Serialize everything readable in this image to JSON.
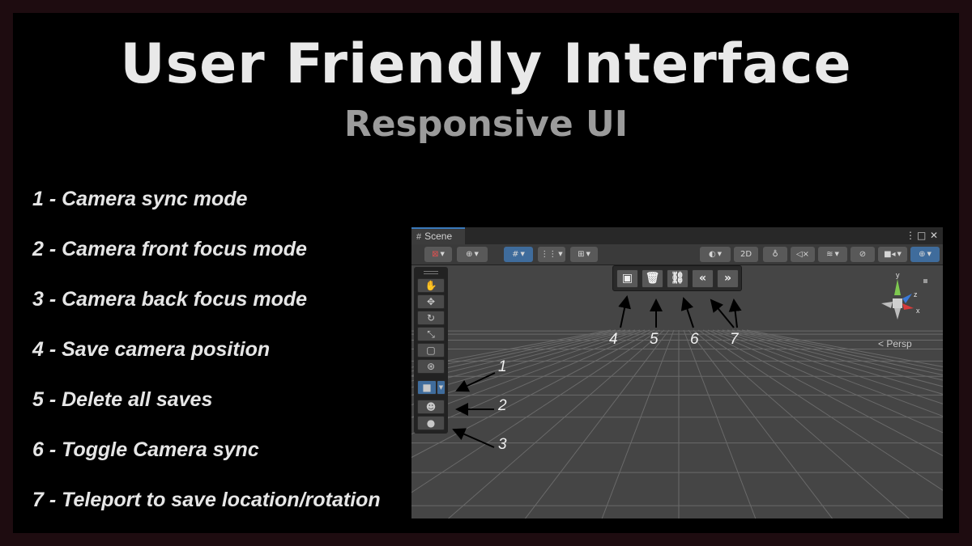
{
  "heading": {
    "title": "User Friendly Interface",
    "subtitle": "Responsive UI"
  },
  "legend": [
    "1 - Camera sync mode",
    "2 - Camera front focus mode",
    "3 - Camera back focus mode",
    "4 - Save camera position",
    "5 - Delete all saves",
    "6 - Toggle Camera sync",
    "7 - Teleport to save location/rotation"
  ],
  "scene_window": {
    "tab_label": "Scene",
    "toolbar_2d_label": "2D",
    "view_label": "Persp",
    "gizmo_axes": {
      "y": "y",
      "z": "z",
      "x": "x"
    },
    "accent_color": "#3f6c9c"
  },
  "overlay_toolbar": {
    "icons": [
      "save-icon",
      "delete-icon",
      "link-icon",
      "double-chevron-left-icon",
      "double-chevron-right-icon"
    ]
  },
  "callout_numbers": {
    "n1": "1",
    "n2": "2",
    "n3": "3",
    "n4": "4",
    "n5": "5",
    "n6": "6",
    "n7": "7"
  }
}
